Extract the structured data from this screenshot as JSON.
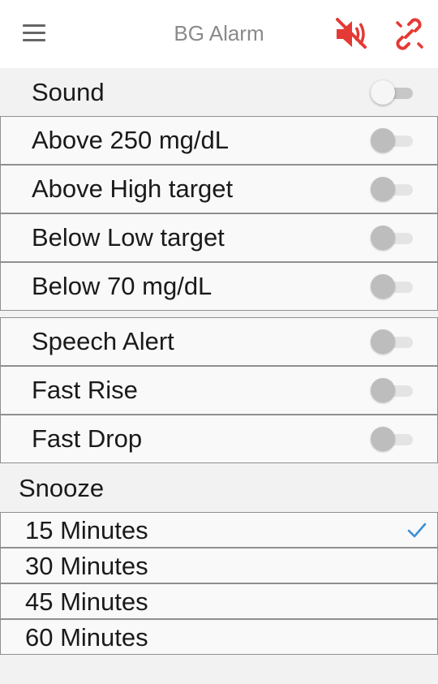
{
  "header": {
    "title": "BG Alarm"
  },
  "icons": {
    "menu": "hamburger-menu-icon",
    "mute": "volume-off-icon",
    "disconnect": "link-off-icon",
    "accent": "#e53935"
  },
  "alarms": [
    {
      "label": "Sound",
      "on": false
    },
    {
      "label": "Above 250 mg/dL",
      "on": false
    },
    {
      "label": "Above High target",
      "on": false
    },
    {
      "label": "Below Low target",
      "on": false
    },
    {
      "label": "Below 70 mg/dL",
      "on": false
    },
    {
      "label": "Speech Alert",
      "on": false
    },
    {
      "label": "Fast Rise",
      "on": false
    },
    {
      "label": "Fast Drop",
      "on": false
    }
  ],
  "snooze": {
    "title": "Snooze",
    "options": [
      {
        "label": "15 Minutes",
        "selected": true
      },
      {
        "label": "30 Minutes",
        "selected": false
      },
      {
        "label": "45 Minutes",
        "selected": false
      },
      {
        "label": "60 Minutes",
        "selected": false
      }
    ],
    "check_color": "#3a8fd8"
  }
}
